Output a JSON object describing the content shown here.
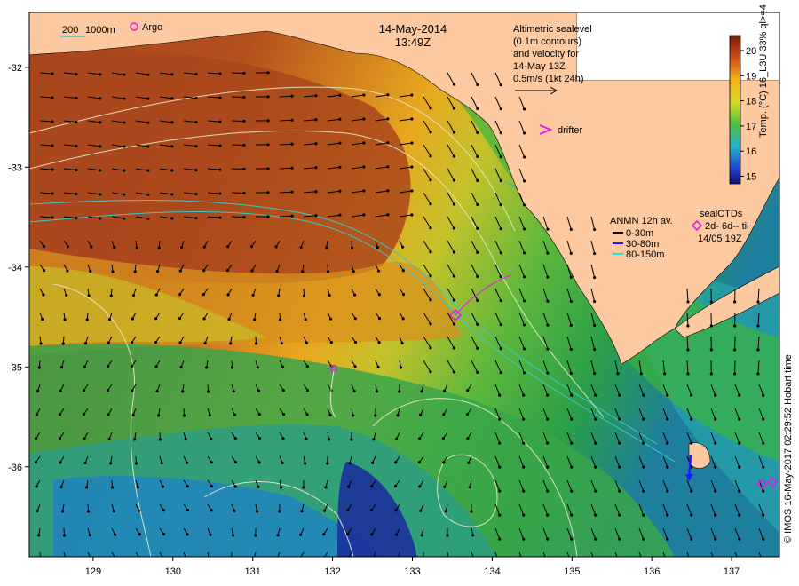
{
  "map": {
    "date": "14-May-2014",
    "time": "13:49Z",
    "x_ticks": [
      "129",
      "130",
      "131",
      "132",
      "133",
      "134",
      "135",
      "136",
      "137"
    ],
    "y_ticks": [
      "-32",
      "-33",
      "-34",
      "-35",
      "-36"
    ],
    "x_range": [
      128.2,
      137.6
    ],
    "y_range": [
      -36.9,
      -31.45
    ]
  },
  "legend": {
    "isobath_200": "200",
    "isobath_1000": "1000m",
    "argo": "Argo",
    "drifter": "drifter",
    "altimetry": [
      "Altimetric sealevel",
      "(0.1m contours)",
      "and velocity for",
      "14-May 13Z",
      "0.5m/s (1kt 24h)"
    ],
    "anmn_title": "ANMN 12h av.",
    "anmn_0_30": "0-30m",
    "anmn_30_80": "30-80m",
    "anmn_80_150": "80-150m",
    "sealctd_title": "sealCTDs",
    "sealctd_line1": "2d- 6d-- til",
    "sealctd_line2": "14/05 19Z"
  },
  "colorbar": {
    "ticks": [
      "20",
      "19",
      "18",
      "17",
      "16",
      "15"
    ],
    "label": "Temp. (°C) 16_L3U 33% ql>=4",
    "range": [
      14.7,
      20.6
    ]
  },
  "credit": "© IMOS 16-May-2017 02:29:52 Hobart time",
  "colors": {
    "land": "#fcc9a0",
    "isobath": "#3cc8c8",
    "marker": "#e020e0",
    "anmn_0_30": "#000000",
    "anmn_30_80": "#1a1aff",
    "anmn_80_150": "#22e0e0"
  }
}
